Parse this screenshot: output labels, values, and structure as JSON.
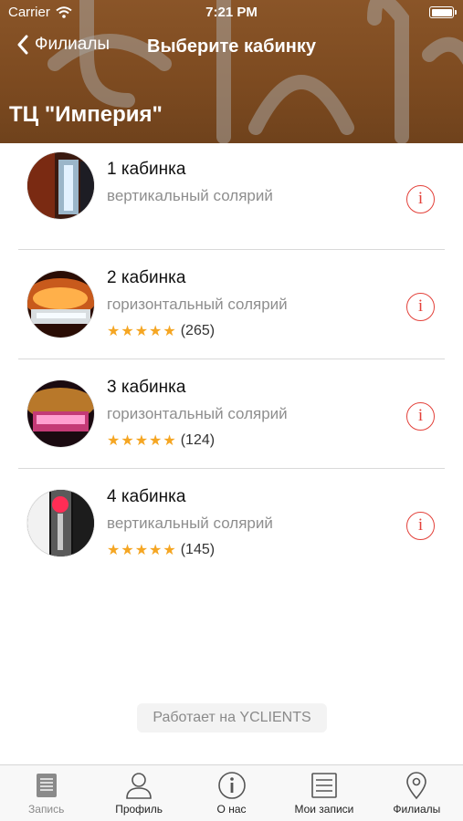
{
  "status_bar": {
    "carrier": "Carrier",
    "time": "7:21 PM"
  },
  "nav": {
    "back_label": "Филиалы",
    "title": "Выберите кабинку"
  },
  "branch": {
    "title": "ТЦ \"Империя\""
  },
  "booths": [
    {
      "name": "1 кабинка",
      "type": "вертикальный солярий",
      "stars": "",
      "rating_count": ""
    },
    {
      "name": "2 кабинка",
      "type": "горизонтальный солярий",
      "stars": "★★★★★",
      "rating_count": "(265)"
    },
    {
      "name": "3 кабинка",
      "type": "горизонтальный солярий",
      "stars": "★★★★★",
      "rating_count": "(124)"
    },
    {
      "name": "4 кабинка",
      "type": "вертикальный солярий",
      "stars": "★★★★★",
      "rating_count": "(145)"
    }
  ],
  "info_glyph": "i",
  "powered_by": "Работает на YCLIENTS",
  "tabbar": {
    "items": [
      {
        "label": "Запись",
        "icon": "book-icon"
      },
      {
        "label": "Профиль",
        "icon": "person-icon"
      },
      {
        "label": "О нас",
        "icon": "info-icon"
      },
      {
        "label": "Мои записи",
        "icon": "list-icon"
      },
      {
        "label": "Филиалы",
        "icon": "map-pin-icon"
      }
    ]
  },
  "colors": {
    "header_brown": "#7c4a20",
    "accent_red": "#e3413a",
    "star_orange": "#f5a623",
    "secondary_text": "#8e8e8e"
  }
}
